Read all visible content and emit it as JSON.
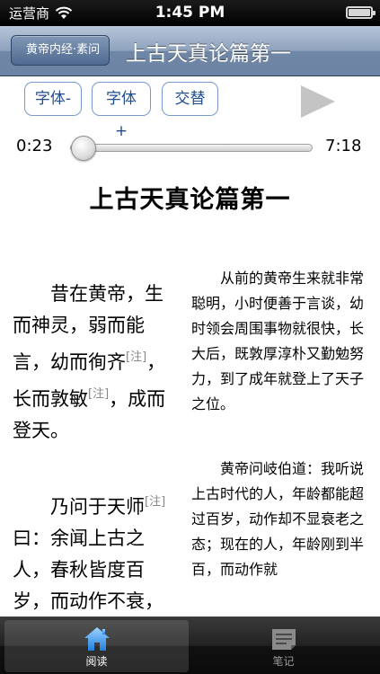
{
  "status_bar": {
    "carrier": "运营商",
    "time": "1:45 PM"
  },
  "nav": {
    "back_label": "黄帝内经·素问",
    "title": "上古天真论篇第一"
  },
  "toolbar": {
    "font_decrease": "字体-",
    "font_increase": "字体+",
    "toggle": "交替",
    "play_icon": "play-icon"
  },
  "player": {
    "elapsed": "0:23",
    "duration": "7:18",
    "progress_fraction": 0.053
  },
  "content": {
    "title": "上古天真论篇第一",
    "note_marker": "[注]",
    "left": {
      "p1": {
        "a": "昔在黄帝，生而神灵，弱而能言，幼而徇齐",
        "b": "，长而敦敏",
        "c": "，成而登天。"
      },
      "p2": {
        "a": "乃问于天师",
        "b": "曰：余闻上古之人，春秋皆度百岁，而动作不衰，今时之人"
      }
    },
    "right": {
      "p1": "从前的黄帝生来就非常聪明，小时便善于言谈，幼时领会周围事物就很快，长大后，既敦厚淳朴又勤勉努力，到了成年就登上了天子之位。",
      "p2": "黄帝问岐伯道：我听说上古时代的人，年龄都能超过百岁，动作却不显衰老之态；现在的人，年龄刚到半百，而动作就"
    }
  },
  "tab_bar": {
    "tabs": [
      {
        "label": "阅读",
        "icon": "house-icon",
        "active": true
      },
      {
        "label": "笔记",
        "icon": "notes-icon",
        "active": false
      }
    ]
  }
}
